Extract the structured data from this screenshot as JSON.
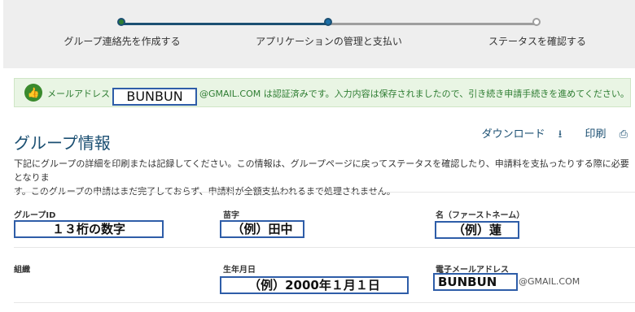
{
  "progress": {
    "steps": [
      {
        "label": "グループ連絡先を作成する"
      },
      {
        "label": "アプリケーションの管理と支払い"
      },
      {
        "label": "ステータスを確認する"
      }
    ]
  },
  "alert": {
    "prefix": "メールアドレス",
    "masked_value": "BUNBUN",
    "suffix": "@GMAIL.COM は認証済みです。入力内容は保存されましたので、引き続き申請手続きを進めてください。"
  },
  "section": {
    "title": "グループ情報",
    "download_label": "ダウンロード",
    "print_label": "印刷",
    "description_line1": "下記にグループの詳細を印刷または記録してください。この情報は、グループページに戻ってステータスを確認したり、申請料を支払ったりする際に必要となりま",
    "description_line2": "す。このグループの申請はまだ完了しておらず、申請料が全額支払われるまで処理されません。"
  },
  "fields": {
    "group_id_label": "グループID",
    "group_id_value": "１３桁の数字",
    "surname_label": "苗字",
    "surname_value": "（例）田中",
    "given_name_label": "名（ファーストネーム）",
    "given_name_value": "（例）蓮",
    "organization_label": "組織",
    "dob_label": "生年月日",
    "dob_value": "（例）2000年１月１日",
    "email_label": "電子メールアドレス",
    "email_value": "BUNBUN",
    "email_suffix": "@GMAIL.COM"
  },
  "colors": {
    "accent": "#1b4f72",
    "success": "#2e7d32",
    "alert_bg": "#e9f5e4",
    "highlight_box": "#2e5da8"
  }
}
